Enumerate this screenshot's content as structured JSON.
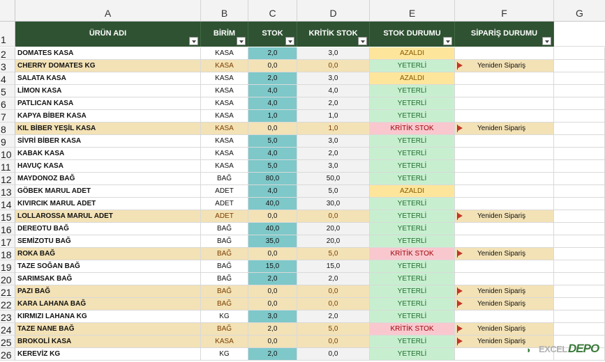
{
  "columns": [
    "A",
    "B",
    "C",
    "D",
    "E",
    "F",
    "G"
  ],
  "headers": {
    "name": "ÜRÜN ADI",
    "unit": "BİRİM",
    "stock": "STOK",
    "critical": "KRİTİK STOK",
    "status": "STOK DURUMU",
    "order": "SİPARİŞ DURUMU"
  },
  "header_row_number": "1",
  "rows": [
    {
      "num": "2",
      "name": "DOMATES KASA",
      "unit": "KASA",
      "stock": "2,0",
      "critical": "3,0",
      "status": "AZALDI",
      "status_type": "azaldi",
      "order": "",
      "highlight": false
    },
    {
      "num": "3",
      "name": "CHERRY DOMATES KG",
      "unit": "KASA",
      "stock": "0,0",
      "critical": "0,0",
      "status": "YETERLİ",
      "status_type": "yeterli",
      "order": "Yeniden Sipariş",
      "highlight": true
    },
    {
      "num": "4",
      "name": "SALATA KASA",
      "unit": "KASA",
      "stock": "2,0",
      "critical": "3,0",
      "status": "AZALDI",
      "status_type": "azaldi",
      "order": "",
      "highlight": false
    },
    {
      "num": "5",
      "name": "LİMON KASA",
      "unit": "KASA",
      "stock": "4,0",
      "critical": "4,0",
      "status": "YETERLİ",
      "status_type": "yeterli",
      "order": "",
      "highlight": false
    },
    {
      "num": "6",
      "name": "PATLICAN KASA",
      "unit": "KASA",
      "stock": "4,0",
      "critical": "2,0",
      "status": "YETERLİ",
      "status_type": "yeterli",
      "order": "",
      "highlight": false
    },
    {
      "num": "7",
      "name": "KAPYA BİBER KASA",
      "unit": "KASA",
      "stock": "1,0",
      "critical": "1,0",
      "status": "YETERLİ",
      "status_type": "yeterli",
      "order": "",
      "highlight": false
    },
    {
      "num": "8",
      "name": "KIL BİBER YEŞİL KASA",
      "unit": "KASA",
      "stock": "0,0",
      "critical": "1,0",
      "status": "KRİTİK STOK",
      "status_type": "kritik",
      "order": "Yeniden Sipariş",
      "highlight": true
    },
    {
      "num": "9",
      "name": "SİVRİ BİBER KASA",
      "unit": "KASA",
      "stock": "5,0",
      "critical": "3,0",
      "status": "YETERLİ",
      "status_type": "yeterli",
      "order": "",
      "highlight": false
    },
    {
      "num": "10",
      "name": "KABAK KASA",
      "unit": "KASA",
      "stock": "4,0",
      "critical": "2,0",
      "status": "YETERLİ",
      "status_type": "yeterli",
      "order": "",
      "highlight": false
    },
    {
      "num": "11",
      "name": "HAVUÇ KASA",
      "unit": "KASA",
      "stock": "5,0",
      "critical": "3,0",
      "status": "YETERLİ",
      "status_type": "yeterli",
      "order": "",
      "highlight": false
    },
    {
      "num": "12",
      "name": "MAYDONOZ BAĞ",
      "unit": "BAĞ",
      "stock": "80,0",
      "critical": "50,0",
      "status": "YETERLİ",
      "status_type": "yeterli",
      "order": "",
      "highlight": false
    },
    {
      "num": "13",
      "name": "GÖBEK MARUL ADET",
      "unit": "ADET",
      "stock": "4,0",
      "critical": "5,0",
      "status": "AZALDI",
      "status_type": "azaldi",
      "order": "",
      "highlight": false
    },
    {
      "num": "14",
      "name": "KIVIRCIK MARUL ADET",
      "unit": "ADET",
      "stock": "40,0",
      "critical": "30,0",
      "status": "YETERLİ",
      "status_type": "yeterli",
      "order": "",
      "highlight": false
    },
    {
      "num": "15",
      "name": "LOLLAROSSA MARUL ADET",
      "unit": "ADET",
      "stock": "0,0",
      "critical": "0,0",
      "status": "YETERLİ",
      "status_type": "yeterli",
      "order": "Yeniden Sipariş",
      "highlight": true
    },
    {
      "num": "16",
      "name": "DEREOTU BAĞ",
      "unit": "BAĞ",
      "stock": "40,0",
      "critical": "20,0",
      "status": "YETERLİ",
      "status_type": "yeterli",
      "order": "",
      "highlight": false
    },
    {
      "num": "17",
      "name": "SEMİZOTU BAĞ",
      "unit": "BAĞ",
      "stock": "35,0",
      "critical": "20,0",
      "status": "YETERLİ",
      "status_type": "yeterli",
      "order": "",
      "highlight": false
    },
    {
      "num": "18",
      "name": "ROKA BAĞ",
      "unit": "BAĞ",
      "stock": "0,0",
      "critical": "5,0",
      "status": "KRİTİK STOK",
      "status_type": "kritik",
      "order": "Yeniden Sipariş",
      "highlight": true
    },
    {
      "num": "19",
      "name": "TAZE SOĞAN BAĞ",
      "unit": "BAĞ",
      "stock": "15,0",
      "critical": "15,0",
      "status": "YETERLİ",
      "status_type": "yeterli",
      "order": "",
      "highlight": false
    },
    {
      "num": "20",
      "name": "SARIMSAK BAĞ",
      "unit": "BAĞ",
      "stock": "2,0",
      "critical": "2,0",
      "status": "YETERLİ",
      "status_type": "yeterli",
      "order": "",
      "highlight": false
    },
    {
      "num": "21",
      "name": "PAZI BAĞ",
      "unit": "BAĞ",
      "stock": "0,0",
      "critical": "0,0",
      "status": "YETERLİ",
      "status_type": "yeterli",
      "order": "Yeniden Sipariş",
      "highlight": true
    },
    {
      "num": "22",
      "name": "KARA LAHANA BAĞ",
      "unit": "BAĞ",
      "stock": "0,0",
      "critical": "0,0",
      "status": "YETERLİ",
      "status_type": "yeterli",
      "order": "Yeniden Sipariş",
      "highlight": true
    },
    {
      "num": "23",
      "name": "KIRMIZI LAHANA KG",
      "unit": "KG",
      "stock": "3,0",
      "critical": "2,0",
      "status": "YETERLİ",
      "status_type": "yeterli",
      "order": "",
      "highlight": false
    },
    {
      "num": "24",
      "name": "TAZE NANE BAĞ",
      "unit": "BAĞ",
      "stock": "2,0",
      "critical": "5,0",
      "status": "KRİTİK STOK",
      "status_type": "kritik",
      "order": "Yeniden Sipariş",
      "highlight": true
    },
    {
      "num": "25",
      "name": "BROKOLİ KASA",
      "unit": "KASA",
      "stock": "0,0",
      "critical": "0,0",
      "status": "YETERLİ",
      "status_type": "yeterli",
      "order": "Yeniden Sipariş",
      "highlight": true
    },
    {
      "num": "26",
      "name": "KEREVİZ KG",
      "unit": "KG",
      "stock": "2,0",
      "critical": "0,0",
      "status": "YETERLİ",
      "status_type": "yeterli",
      "order": "",
      "highlight": false
    }
  ],
  "watermark": {
    "part1": "EXCEL",
    "part2": "DEPO"
  },
  "colors": {
    "header_bg": "#2f5232",
    "stock_bg": "#7ec8c9",
    "yeterli": "#c7efcf",
    "azaldi": "#fde69b",
    "kritik": "#f9c8ce",
    "highlight": "#f3e2b6"
  }
}
